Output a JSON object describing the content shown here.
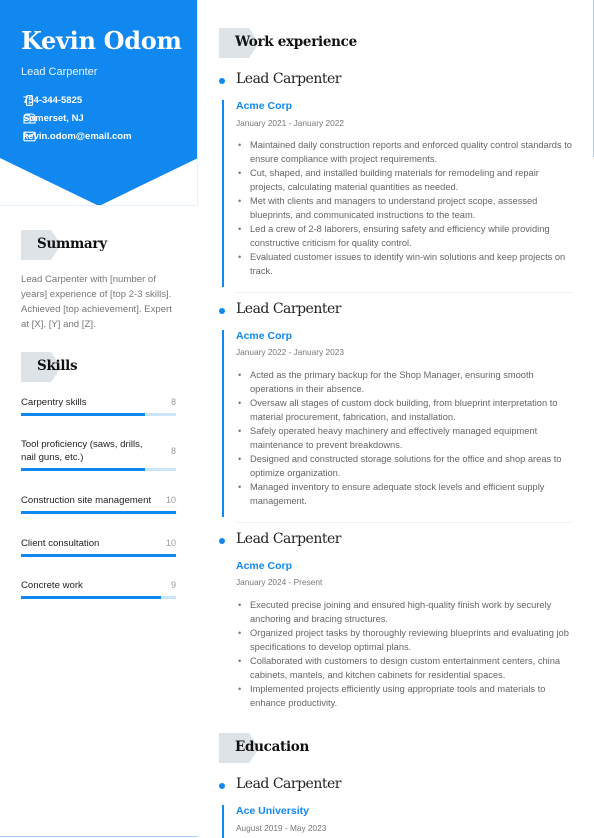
{
  "profile": {
    "name": "Kevin Odom",
    "role": "Lead Carpenter",
    "contacts": [
      {
        "icon": "phone-icon",
        "text": "754-344-5825"
      },
      {
        "icon": "mailbox-icon",
        "text": "Somerset, NJ"
      },
      {
        "icon": "email-icon",
        "text": "kevin.odom@email.com"
      }
    ]
  },
  "colors": {
    "accent": "#1088f0",
    "header_tab": "#dde3e6",
    "bar_track": "#cce5fb"
  },
  "summary": {
    "heading": "Summary",
    "text": "Lead Carpenter with [number of years] experience of [top 2-3 skills]. Achieved [top achievement]. Expert at [X], [Y] and [Z]."
  },
  "skills": {
    "heading": "Skills",
    "items": [
      {
        "label": "Carpentry skills",
        "value": "8",
        "level": 0.8
      },
      {
        "label": "Tool proficiency (saws, drills, nail guns, etc.)",
        "value": "8",
        "level": 0.8
      },
      {
        "label": "Construction site management",
        "value": "10",
        "level": 1.0
      },
      {
        "label": "Client consultation",
        "value": "10",
        "level": 1.0
      },
      {
        "label": "Concrete work",
        "value": "9",
        "level": 0.9
      }
    ]
  },
  "work": {
    "heading": "Work experience",
    "jobs": [
      {
        "title": "Lead Carpenter",
        "company": "Acme Corp",
        "dates": "January 2021 - January 2022",
        "bullets": [
          "Maintained daily construction reports and enforced quality control standards to ensure compliance with project requirements.",
          "Cut, shaped, and installed building materials for remodeling and repair projects, calculating material quantities as needed.",
          "Met with clients and managers to understand project scope, assessed blueprints, and communicated instructions to the team.",
          "Led a crew of 2-8 laborers, ensuring safety and efficiency while providing constructive criticism for quality control.",
          "Evaluated customer issues to identify win-win solutions and keep projects on track."
        ]
      },
      {
        "title": "Lead Carpenter",
        "company": "Acme Corp",
        "dates": "January 2022 - January 2023",
        "bullets": [
          "Acted as the primary backup for the Shop Manager, ensuring smooth operations in their absence.",
          "Oversaw all stages of custom dock building, from blueprint interpretation to material procurement, fabrication, and installation.",
          "Safely operated heavy machinery and effectively managed equipment maintenance to prevent breakdowns.",
          "Designed and constructed storage solutions for the office and shop areas to optimize organization.",
          "Managed inventory to ensure adequate stock levels and efficient supply management."
        ]
      },
      {
        "title": "Lead Carpenter",
        "company": "Acme Corp",
        "dates": "January 2024 - Present",
        "bullets": [
          "Executed precise joining and ensured high-quality finish work by securely anchoring and bracing structures.",
          "Organized project tasks by thoroughly reviewing blueprints and evaluating job specifications to develop optimal plans.",
          "Collaborated with customers to design custom entertainment centers, china cabinets, mantels, and kitchen cabinets for residential spaces.",
          "Implemented projects efficiently using appropriate tools and materials to enhance productivity."
        ]
      }
    ]
  },
  "education": {
    "heading": "Education",
    "entries": [
      {
        "title": "Lead Carpenter",
        "school": "Ace University",
        "dates": "August 2019 - May 2023"
      }
    ]
  }
}
